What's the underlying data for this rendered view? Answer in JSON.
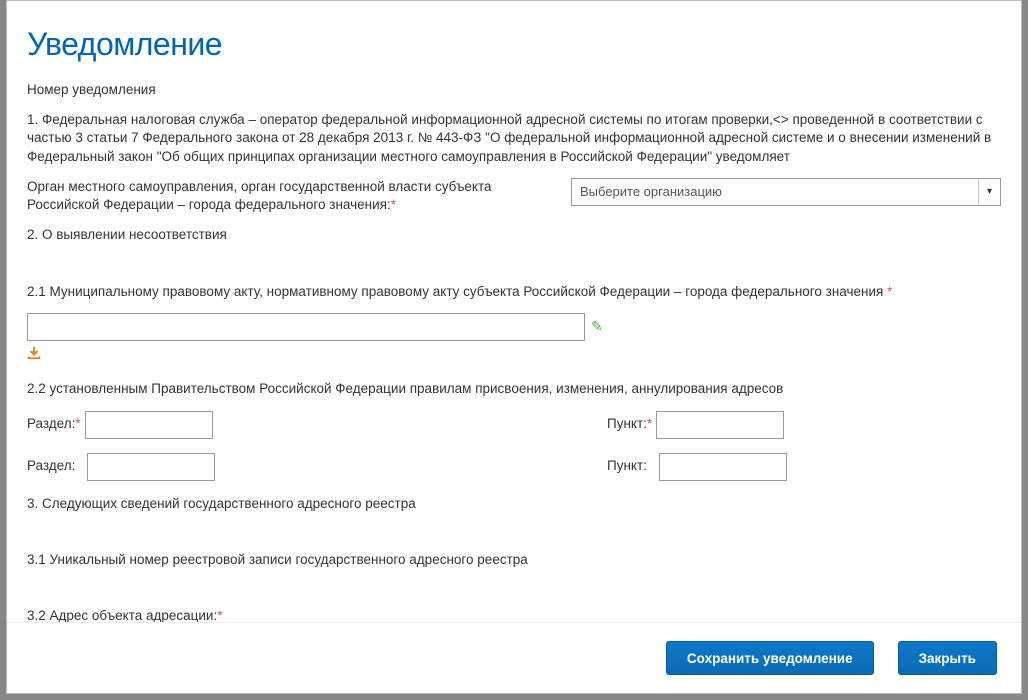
{
  "title": "Уведомление",
  "body": {
    "notif_number_label": "Номер уведомления",
    "para1": "1. Федеральная налоговая служба – оператор федеральной информационной адресной системы по итогам проверки,<> проведенной в соответствии с частью 3 статьи 7 Федерального закона от 28 декабря 2013 г. № 443-ФЗ \"О федеральной информационной адресной системе и о внесении изменений в Федеральный закон \"Об общих принципах организации местного самоуправления в Российской Федерации\" уведомляет",
    "organ_label": "Орган местного самоуправления, орган государственной власти субъекта Российской Федерации – города федерального значения:",
    "org_select_placeholder": "Выберите организацию",
    "para2": "2. О выявлении несоответствия",
    "para2_1": "2.1 Муниципальному правовому акту, нормативному правовому акту субъекта Российской Федерации – города федерального значения ",
    "act_input_value": "",
    "para2_2": "2.2 установленным Правительством Российской Федерации правилам присвоения, изменения, аннулирования адресов",
    "section_label_req": "Раздел:",
    "section_label": "Раздел:",
    "point_label_req": "Пункт:",
    "point_label": "Пункт:",
    "section1_value": "",
    "section2_value": "",
    "point1_value": "",
    "point2_value": "",
    "para3": "3. Следующих сведений государственного адресного реестра",
    "para3_1": "3.1 Уникальный номер реестровой записи государственного адресного реестра",
    "para3_2": "3.2 Адрес объекта адресации:"
  },
  "footer": {
    "save_label": "Сохранить уведомление",
    "close_label": "Закрыть"
  }
}
